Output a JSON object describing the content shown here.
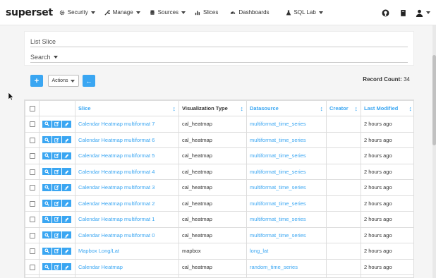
{
  "navbar": {
    "brand": "superset",
    "items": [
      {
        "label": "Security",
        "icon": "gear-icon",
        "dropdown": true
      },
      {
        "label": "Manage",
        "icon": "wrench-icon",
        "dropdown": true
      },
      {
        "label": "Sources",
        "icon": "database-icon",
        "dropdown": true
      },
      {
        "label": "Slices",
        "icon": "bar-chart-icon",
        "dropdown": false
      },
      {
        "label": "Dashboards",
        "icon": "dashboard-icon",
        "dropdown": false
      },
      {
        "label": "SQL Lab",
        "icon": "flask-icon",
        "dropdown": true
      }
    ],
    "right_icons": [
      "github-icon",
      "book-icon",
      "user-icon"
    ]
  },
  "panel": {
    "title": "List Slice",
    "search_label": "Search"
  },
  "toolbar": {
    "add_label": "+",
    "actions_label": "Actions",
    "back_label": "←",
    "record_count_label": "Record Count:",
    "record_count": "34"
  },
  "table": {
    "columns": [
      "Slice",
      "Visualization Type",
      "Datasource",
      "Creator",
      "Last Modified"
    ],
    "rows": [
      {
        "slice": "Calendar Heatmap multiformat 7",
        "viz": "cal_heatmap",
        "datasource": "multiformat_time_series",
        "creator": "",
        "modified": "2 hours ago"
      },
      {
        "slice": "Calendar Heatmap multiformat 6",
        "viz": "cal_heatmap",
        "datasource": "multiformat_time_series",
        "creator": "",
        "modified": "2 hours ago"
      },
      {
        "slice": "Calendar Heatmap multiformat 5",
        "viz": "cal_heatmap",
        "datasource": "multiformat_time_series",
        "creator": "",
        "modified": "2 hours ago"
      },
      {
        "slice": "Calendar Heatmap multiformat 4",
        "viz": "cal_heatmap",
        "datasource": "multiformat_time_series",
        "creator": "",
        "modified": "2 hours ago"
      },
      {
        "slice": "Calendar Heatmap multiformat 3",
        "viz": "cal_heatmap",
        "datasource": "multiformat_time_series",
        "creator": "",
        "modified": "2 hours ago"
      },
      {
        "slice": "Calendar Heatmap multiformat 2",
        "viz": "cal_heatmap",
        "datasource": "multiformat_time_series",
        "creator": "",
        "modified": "2 hours ago"
      },
      {
        "slice": "Calendar Heatmap multiformat 1",
        "viz": "cal_heatmap",
        "datasource": "multiformat_time_series",
        "creator": "",
        "modified": "2 hours ago"
      },
      {
        "slice": "Calendar Heatmap multiformat 0",
        "viz": "cal_heatmap",
        "datasource": "multiformat_time_series",
        "creator": "",
        "modified": "2 hours ago"
      },
      {
        "slice": "Mapbox Long/Lat",
        "viz": "mapbox",
        "datasource": "long_lat",
        "creator": "",
        "modified": "2 hours ago"
      },
      {
        "slice": "Calendar Heatmap",
        "viz": "cal_heatmap",
        "datasource": "random_time_series",
        "creator": "",
        "modified": "2 hours ago"
      },
      {
        "slice": "",
        "viz": "",
        "datasource": "",
        "creator": "",
        "modified": ""
      }
    ]
  },
  "colors": {
    "accent": "#3aa6f2",
    "text": "#333333",
    "border": "#dddddd"
  }
}
